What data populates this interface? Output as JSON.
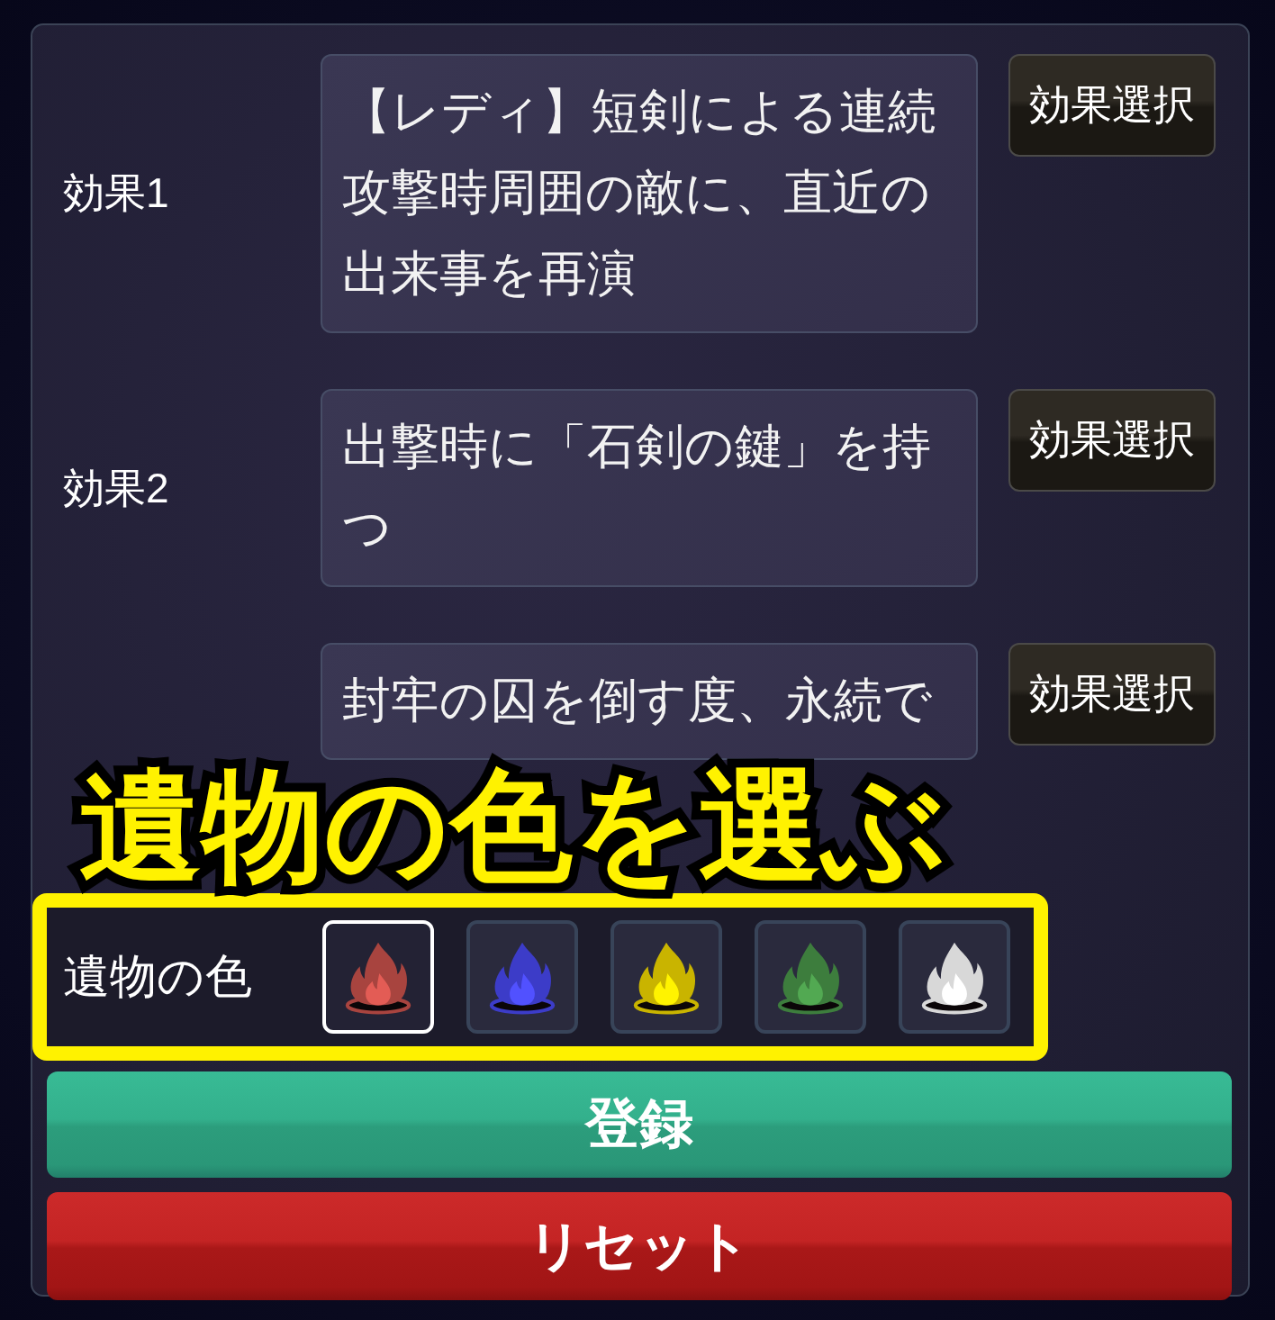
{
  "effects": [
    {
      "label": "効果1",
      "text": "【レディ】短剣による連続攻撃時周囲の敵に、直近の出来事を再演",
      "button": "効果選択"
    },
    {
      "label": "効果2",
      "text": "出撃時に「石剣の鍵」を持つ",
      "button": "効果選択"
    },
    {
      "text": "封牢の囚を倒す度、永続で",
      "button": "効果選択"
    }
  ],
  "caption": {
    "text": "遺物の色を選ぶ"
  },
  "relic_color": {
    "label": "遺物の色",
    "options": [
      {
        "selected": true,
        "color": "#a8443f"
      },
      {
        "selected": false,
        "color": "#3c3cc8"
      },
      {
        "selected": false,
        "color": "#c9b400"
      },
      {
        "selected": false,
        "color": "#3d7d3d"
      },
      {
        "selected": false,
        "color": "#d8d8d8"
      }
    ]
  },
  "buttons": [
    {
      "label": "登録",
      "kind": "register"
    },
    {
      "label": "リセット",
      "kind": "reset"
    }
  ]
}
